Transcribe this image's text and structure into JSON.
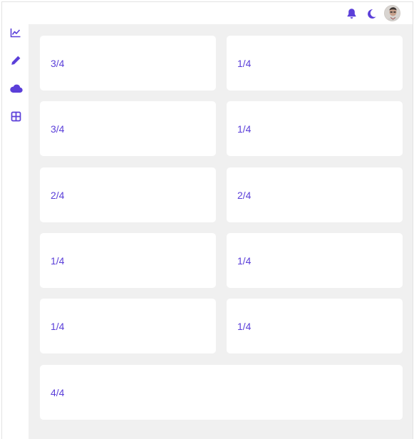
{
  "colors": {
    "accent": "#5b3fd9",
    "background": "#f0f0f0",
    "card": "#ffffff"
  },
  "header": {
    "icons": [
      "bell-icon",
      "moon-icon"
    ],
    "avatar": "user-avatar"
  },
  "sidebar": {
    "items": [
      {
        "icon": "chart-line-icon"
      },
      {
        "icon": "pencil-icon"
      },
      {
        "icon": "cloud-icon"
      },
      {
        "icon": "grid-icon"
      }
    ]
  },
  "cards": [
    {
      "label": "3/4"
    },
    {
      "label": "1/4"
    },
    {
      "label": "3/4"
    },
    {
      "label": "1/4"
    },
    {
      "label": "2/4"
    },
    {
      "label": "2/4"
    },
    {
      "label": "1/4"
    },
    {
      "label": "1/4"
    },
    {
      "label": "1/4"
    },
    {
      "label": "1/4"
    },
    {
      "label": "4/4"
    }
  ]
}
